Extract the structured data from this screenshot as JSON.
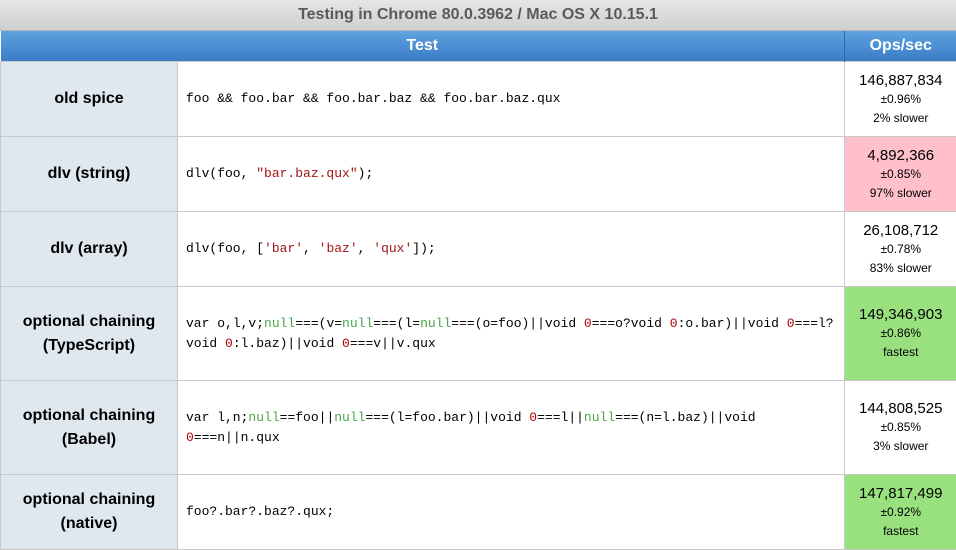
{
  "caption": "Testing in Chrome 80.0.3962 / Mac OS X 10.15.1",
  "headers": {
    "test": "Test",
    "ops": "Ops/sec"
  },
  "rows": [
    {
      "name_lines": [
        "old spice"
      ],
      "code_lines": [
        [
          {
            "t": "foo && foo.bar && foo.bar.baz && foo.bar.baz.qux",
            "c": ""
          }
        ]
      ],
      "hz": "146,887,834",
      "rme": "±0.96%",
      "status": "2% slower",
      "highlight": ""
    },
    {
      "name_lines": [
        "dlv (string)"
      ],
      "code_lines": [
        [
          {
            "t": "dlv(foo, ",
            "c": ""
          },
          {
            "t": "\"bar.baz.qux\"",
            "c": "str"
          },
          {
            "t": ");",
            "c": ""
          }
        ]
      ],
      "hz": "4,892,366",
      "rme": "±0.85%",
      "status": "97% slower",
      "highlight": "slowest"
    },
    {
      "name_lines": [
        "dlv (array)"
      ],
      "code_lines": [
        [
          {
            "t": "dlv(foo, [",
            "c": ""
          },
          {
            "t": "'bar'",
            "c": "str"
          },
          {
            "t": ", ",
            "c": ""
          },
          {
            "t": "'baz'",
            "c": "str"
          },
          {
            "t": ", ",
            "c": ""
          },
          {
            "t": "'qux'",
            "c": "str"
          },
          {
            "t": "]);",
            "c": ""
          }
        ]
      ],
      "hz": "26,108,712",
      "rme": "±0.78%",
      "status": "83% slower",
      "highlight": ""
    },
    {
      "name_lines": [
        "optional chaining",
        "(TypeScript)"
      ],
      "code_lines": [
        [
          {
            "t": "var o,l,v;",
            "c": ""
          },
          {
            "t": "null",
            "c": "kw"
          },
          {
            "t": "===(v=",
            "c": ""
          },
          {
            "t": "null",
            "c": "kw"
          },
          {
            "t": "===(l=",
            "c": ""
          },
          {
            "t": "null",
            "c": "kw"
          },
          {
            "t": "===(o=foo)||void ",
            "c": ""
          },
          {
            "t": "0",
            "c": "num"
          },
          {
            "t": "===o?void ",
            "c": ""
          },
          {
            "t": "0",
            "c": "num"
          },
          {
            "t": ":o.bar)||void ",
            "c": ""
          },
          {
            "t": "0",
            "c": "num"
          },
          {
            "t": "===l?",
            "c": ""
          }
        ],
        [
          {
            "t": "void ",
            "c": ""
          },
          {
            "t": "0",
            "c": "num"
          },
          {
            "t": ":l.baz)||void ",
            "c": ""
          },
          {
            "t": "0",
            "c": "num"
          },
          {
            "t": "===v||v.qux",
            "c": ""
          }
        ]
      ],
      "hz": "149,346,903",
      "rme": "±0.86%",
      "status": "fastest",
      "highlight": "fastest"
    },
    {
      "name_lines": [
        "optional chaining",
        "(Babel)"
      ],
      "code_lines": [
        [
          {
            "t": "var l,n;",
            "c": ""
          },
          {
            "t": "null",
            "c": "kw"
          },
          {
            "t": "==foo||",
            "c": ""
          },
          {
            "t": "null",
            "c": "kw"
          },
          {
            "t": "===(l=foo.bar)||void ",
            "c": ""
          },
          {
            "t": "0",
            "c": "num"
          },
          {
            "t": "===l||",
            "c": ""
          },
          {
            "t": "null",
            "c": "kw"
          },
          {
            "t": "===(n=l.baz)||void",
            "c": ""
          }
        ],
        [
          {
            "t": "0",
            "c": "num"
          },
          {
            "t": "===n||n.qux",
            "c": ""
          }
        ]
      ],
      "hz": "144,808,525",
      "rme": "±0.85%",
      "status": "3% slower",
      "highlight": ""
    },
    {
      "name_lines": [
        "optional chaining",
        "(native)"
      ],
      "code_lines": [
        [
          {
            "t": "foo?.bar?.baz?.qux;",
            "c": ""
          }
        ]
      ],
      "hz": "147,817,499",
      "rme": "±0.92%",
      "status": "fastest",
      "highlight": "fastest"
    }
  ]
}
